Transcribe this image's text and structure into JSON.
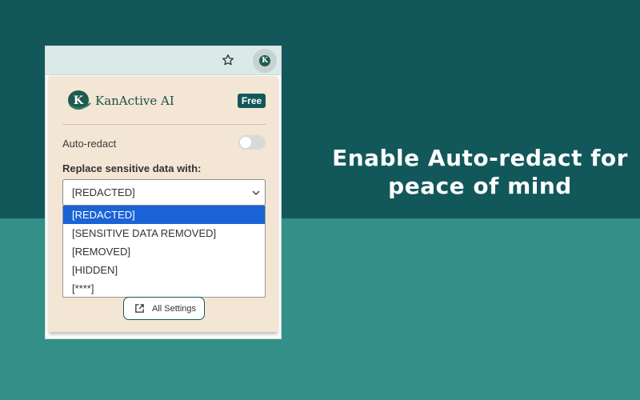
{
  "headline": {
    "line1": "Enable Auto-redact for",
    "line2": "peace of mind"
  },
  "browser": {
    "star_icon": "star-icon",
    "extension_icon": "kanactive-k-icon",
    "extension_letter": "K"
  },
  "popup": {
    "logo_letter": "K",
    "brand_name": "KanActive AI",
    "plan_badge": "Free",
    "auto_redact_label": "Auto-redact",
    "auto_redact_enabled": false,
    "replace_label": "Replace sensitive data with:",
    "selected_value": "[REDACTED]",
    "options": [
      "[REDACTED]",
      "[SENSITIVE DATA REMOVED]",
      "[REMOVED]",
      "[HIDDEN]",
      "[****]"
    ],
    "highlighted_option": 0,
    "settings_button": "All Settings"
  },
  "colors": {
    "bg_top": "#12585a",
    "bg_bottom": "#338f87",
    "panel": "#f3e6d4",
    "accent": "#12585a",
    "highlight": "#1a63d6"
  }
}
